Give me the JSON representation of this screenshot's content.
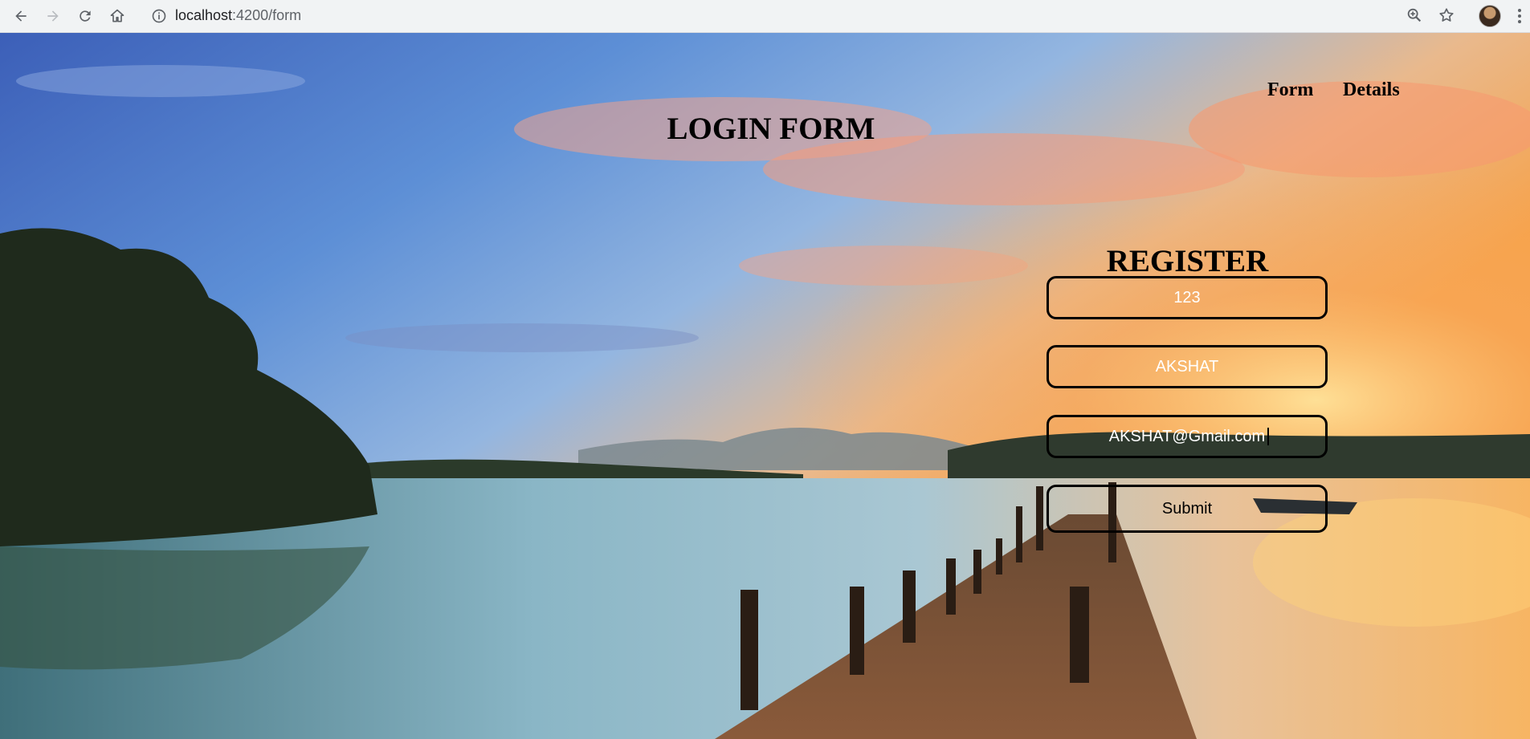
{
  "browser": {
    "url_host": "localhost",
    "url_path": ":4200/form"
  },
  "nav": {
    "form_label": "Form",
    "details_label": "Details"
  },
  "page": {
    "login_title": "LOGIN FORM",
    "register_title": "REGISTER"
  },
  "form": {
    "id_value": "123",
    "name_value": "AKSHAT",
    "email_value": "AKSHAT@Gmail.com",
    "submit_label": "Submit"
  }
}
